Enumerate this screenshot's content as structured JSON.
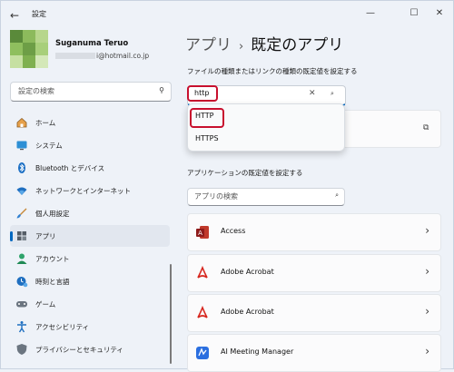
{
  "window": {
    "title": "設定",
    "back_icon": "←",
    "min_icon": "—",
    "max_icon": "☐",
    "close_icon": "✕"
  },
  "profile": {
    "name": "Suganuma Teruo",
    "email_suffix": "i@hotmail.co.jp"
  },
  "sidebar": {
    "search_placeholder": "設定の検索",
    "items": [
      {
        "label": "ホーム",
        "icon": "home-icon"
      },
      {
        "label": "システム",
        "icon": "system-icon"
      },
      {
        "label": "Bluetooth とデバイス",
        "icon": "bluetooth-icon"
      },
      {
        "label": "ネットワークとインターネット",
        "icon": "network-icon"
      },
      {
        "label": "個人用設定",
        "icon": "personalization-icon"
      },
      {
        "label": "アプリ",
        "icon": "apps-icon",
        "selected": true
      },
      {
        "label": "アカウント",
        "icon": "account-icon"
      },
      {
        "label": "時刻と言語",
        "icon": "time-language-icon"
      },
      {
        "label": "ゲーム",
        "icon": "gaming-icon"
      },
      {
        "label": "アクセシビリティ",
        "icon": "accessibility-icon"
      },
      {
        "label": "プライバシーとセキュリティ",
        "icon": "privacy-icon"
      }
    ]
  },
  "main": {
    "breadcrumb": {
      "parent": "アプリ",
      "separator": "›",
      "current": "既定のアプリ"
    },
    "file_types_label": "ファイルの種類またはリンクの種類の既定値を設定する",
    "type_search": {
      "value": "http",
      "clear": "✕",
      "icon": "⌕"
    },
    "dropdown": {
      "options": [
        "HTTP",
        "HTTPS"
      ],
      "highlighted": "HTTP"
    },
    "apps_label": "アプリケーションの既定値を設定する",
    "app_search_placeholder": "アプリの検索",
    "apps": [
      {
        "name": "Access",
        "icon": "access-icon"
      },
      {
        "name": "Adobe Acrobat",
        "icon": "acrobat-icon"
      },
      {
        "name": "Adobe Acrobat",
        "icon": "acrobat-icon"
      },
      {
        "name": "AI Meeting Manager",
        "icon": "ai-meeting-manager-icon"
      }
    ],
    "chevron": "›",
    "external_icon": "⧉"
  },
  "colors": {
    "accent": "#0067c0",
    "highlight": "#c8102e",
    "background": "#eef2f8"
  }
}
